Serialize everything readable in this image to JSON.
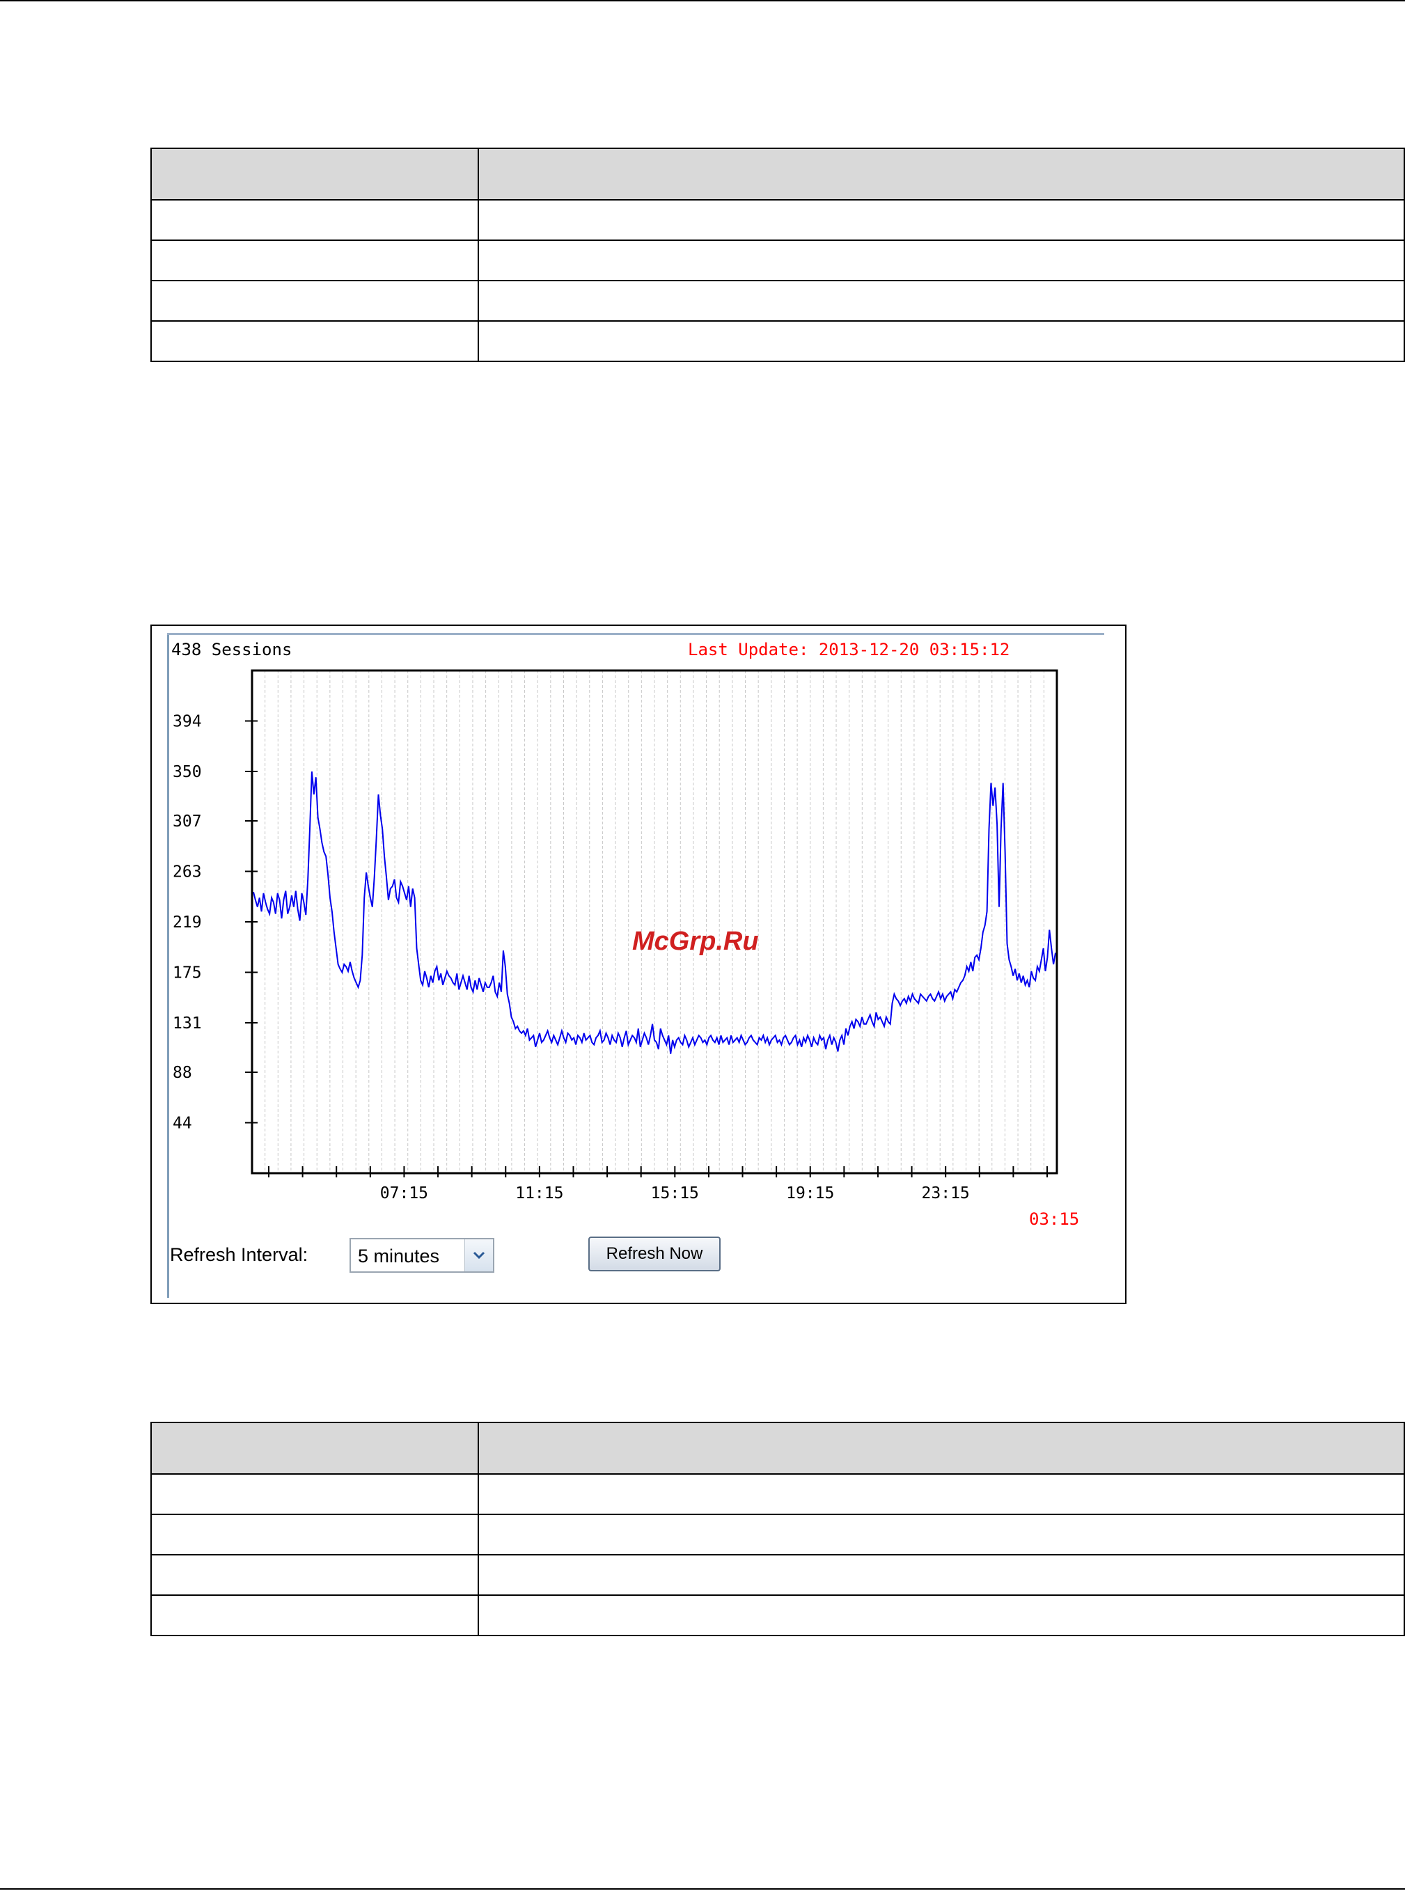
{
  "table_top": {
    "header": [
      "",
      ""
    ],
    "rows": [
      [
        "",
        ""
      ],
      [
        "",
        ""
      ],
      [
        "",
        ""
      ],
      [
        "",
        ""
      ]
    ]
  },
  "table_bottom": {
    "header": [
      "",
      ""
    ],
    "rows": [
      [
        "",
        ""
      ],
      [
        "",
        ""
      ],
      [
        "",
        ""
      ],
      [
        "",
        ""
      ]
    ]
  },
  "screenshot": {
    "sessions_label": "438 Sessions",
    "last_update": "Last Update: 2013-12-20 03:15:12",
    "end_time": "03:15",
    "watermark": "McGrp.Ru",
    "refresh_label": "Refresh Interval:",
    "refresh_interval_value": "5 minutes",
    "refresh_button": "Refresh Now"
  },
  "colors": {
    "line": "#0000ee",
    "red_text": "#ff0000",
    "grid": "#c8c8c8"
  },
  "chart_data": {
    "type": "line",
    "title": "438 Sessions",
    "subtitle": "Last Update: 2013-12-20 03:15:12",
    "y_ticks": [
      44,
      88,
      131,
      175,
      219,
      263,
      307,
      350,
      394
    ],
    "ylim": [
      0,
      438
    ],
    "x_tick_labels": [
      "07:15",
      "11:15",
      "15:15",
      "19:15",
      "23:15"
    ],
    "x_tick_label_index": [
      4,
      8,
      12,
      16,
      20
    ],
    "x_minor_ticks": 24,
    "x_range_hours": [
      0,
      24
    ],
    "grid": true,
    "series": [
      {
        "values": [
          245,
          238,
          232,
          240,
          228,
          244,
          236,
          230,
          226,
          240,
          236,
          226,
          244,
          238,
          222,
          238,
          246,
          226,
          232,
          242,
          232,
          246,
          230,
          220,
          244,
          236,
          225,
          256,
          300,
          350,
          330,
          345,
          310,
          300,
          288,
          280,
          276,
          260,
          240,
          228,
          210,
          196,
          182,
          178,
          175,
          182,
          180,
          176,
          184,
          176,
          170,
          166,
          162,
          168,
          190,
          240,
          262,
          250,
          240,
          232,
          258,
          292,
          330,
          312,
          300,
          276,
          258,
          238,
          248,
          250,
          256,
          240,
          236,
          254,
          250,
          244,
          238,
          250,
          232,
          248,
          240,
          196,
          182,
          168,
          164,
          176,
          170,
          162,
          172,
          166,
          176,
          180,
          168,
          174,
          164,
          170,
          176,
          172,
          170,
          166,
          164,
          174,
          160,
          166,
          172,
          166,
          160,
          172,
          162,
          158,
          168,
          160,
          170,
          164,
          158,
          166,
          162,
          162,
          166,
          172,
          158,
          154,
          166,
          158,
          194,
          180,
          156,
          148,
          136,
          132,
          126,
          128,
          124,
          122,
          124,
          120,
          126,
          116,
          118,
          120,
          110,
          116,
          122,
          114,
          116,
          120,
          124,
          118,
          114,
          120,
          116,
          112,
          118,
          124,
          118,
          114,
          122,
          120,
          116,
          118,
          112,
          120,
          118,
          114,
          122,
          116,
          118,
          120,
          114,
          112,
          118,
          120,
          124,
          114,
          116,
          122,
          118,
          112,
          120,
          116,
          114,
          122,
          118,
          110,
          118,
          124,
          112,
          116,
          120,
          118,
          114,
          126,
          110,
          116,
          122,
          118,
          112,
          120,
          130,
          116,
          114,
          108,
          126,
          120,
          116,
          112,
          120,
          104,
          116,
          110,
          116,
          118,
          114,
          112,
          120,
          116,
          110,
          114,
          118,
          112,
          116,
          120,
          118,
          114,
          116,
          112,
          118,
          120,
          116,
          114,
          118,
          112,
          120,
          114,
          116,
          118,
          112,
          120,
          114,
          116,
          118,
          114,
          120,
          116,
          112,
          114,
          118,
          120,
          116,
          114,
          112,
          118,
          116,
          120,
          114,
          118,
          112,
          116,
          118,
          120,
          114,
          116,
          112,
          118,
          120,
          116,
          112,
          114,
          118,
          120,
          112,
          116,
          110,
          118,
          114,
          120,
          116,
          110,
          118,
          114,
          112,
          120,
          116,
          118,
          108,
          116,
          120,
          112,
          118,
          114,
          106,
          116,
          120,
          112,
          126,
          120,
          128,
          132,
          126,
          134,
          132,
          128,
          136,
          130,
          130,
          134,
          138,
          132,
          128,
          140,
          134,
          136,
          132,
          128,
          136,
          132,
          130,
          148,
          156,
          152,
          150,
          146,
          150,
          152,
          148,
          154,
          150,
          156,
          152,
          150,
          148,
          156,
          154,
          152,
          150,
          154,
          156,
          152,
          150,
          154,
          158,
          152,
          156,
          150,
          154,
          156,
          158,
          152,
          160,
          158,
          162,
          166,
          168,
          172,
          180,
          176,
          184,
          176,
          188,
          190,
          186,
          196,
          210,
          216,
          228,
          300,
          340,
          320,
          336,
          304,
          232,
          300,
          340,
          280,
          200,
          186,
          180,
          172,
          178,
          168,
          174,
          166,
          172,
          164,
          168,
          162,
          176,
          170,
          168,
          180,
          176,
          186,
          196,
          176,
          188,
          212,
          196,
          182,
          192
        ]
      }
    ]
  }
}
